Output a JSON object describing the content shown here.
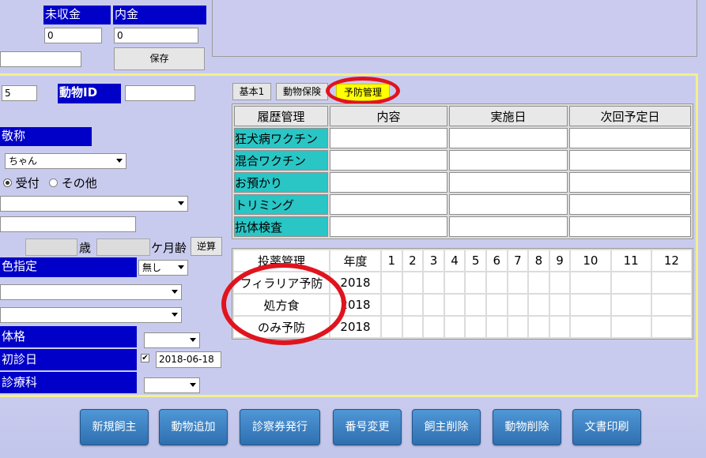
{
  "top": {
    "unpaid_label": "未収金",
    "unpaid_value": "0",
    "deposit_label": "内金",
    "deposit_value": "0",
    "save_label": "保存"
  },
  "animal": {
    "count_value": "5",
    "id_label": "動物ID",
    "id_value": "",
    "honorific_label": "敬称",
    "honorific_value": "ちゃん",
    "radio_reception": "受付",
    "radio_other": "その他",
    "age_years_unit": "歳",
    "age_months_unit": "ケ月齢",
    "reverse_calc_label": "逆算",
    "color_label": "色指定",
    "color_value": "無し",
    "body_label": "体格",
    "first_visit_label": "初診日",
    "first_visit_value": "2018-06-18",
    "department_label": "診療科"
  },
  "tabs": [
    "基本1",
    "動物保険",
    "予防管理"
  ],
  "history": {
    "headers": [
      "履歴管理",
      "内容",
      "実施日",
      "次回予定日"
    ],
    "rows": [
      "狂犬病ワクチン",
      "混合ワクチン",
      "お預かり",
      "トリミング",
      "抗体検査"
    ]
  },
  "medication": {
    "header": "投薬管理",
    "year_header": "年度",
    "months": [
      "1",
      "2",
      "3",
      "4",
      "5",
      "6",
      "7",
      "8",
      "9",
      "10",
      "11",
      "12"
    ],
    "rows": [
      {
        "name": "フィラリア予防",
        "year": "2018"
      },
      {
        "name": "処方食",
        "year": "2018"
      },
      {
        "name": "のみ予防",
        "year": "2018"
      }
    ]
  },
  "bottom_buttons": [
    "新規飼主",
    "動物追加",
    "診察券発行",
    "番号変更",
    "飼主削除",
    "動物削除",
    "文書印刷"
  ],
  "colors": {
    "label_blue": "#0000c8",
    "teal": "#2ac5c5",
    "background": "#c9cbee",
    "highlight_ring": "#e0141e",
    "tab_yellow": "#ffff00"
  }
}
